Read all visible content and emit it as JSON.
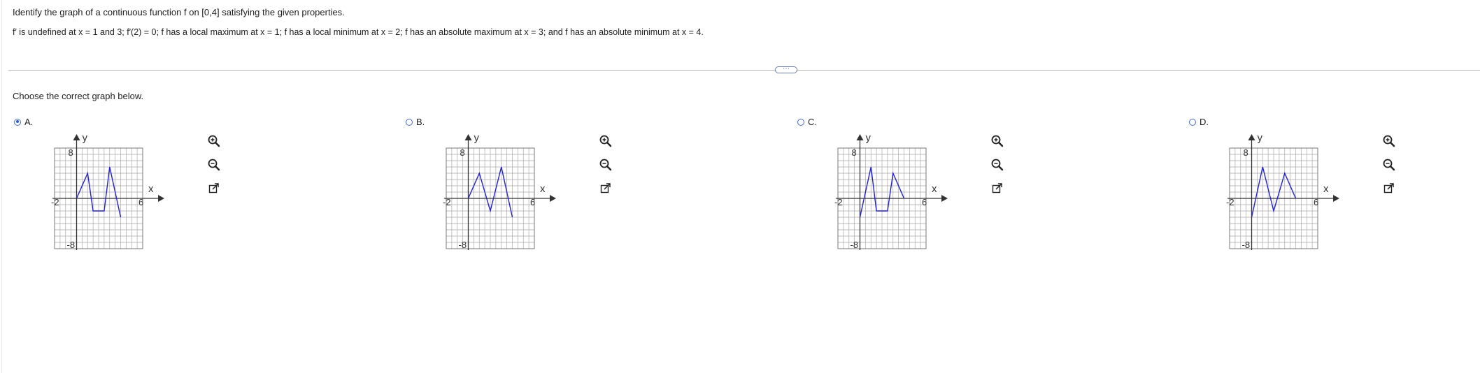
{
  "question": {
    "line1": "Identify the graph of a continuous function f on [0,4] satisfying the given properties.",
    "line2": "f′ is undefined at x = 1 and 3; f′(2) = 0; f has a local maximum at x = 1; f has a local minimum at x = 2; f has an absolute maximum at x = 3; and f has an absolute minimum at x = 4."
  },
  "more_button_label": "⋯",
  "prompt": "Choose the correct graph below.",
  "selected_option": "A",
  "colors": {
    "accent": "#2a5bd7",
    "curve": "#1f1fe0",
    "grid": "#a8a8a8",
    "axis": "#333333"
  },
  "icons": [
    "zoom-in-icon",
    "zoom-out-icon",
    "open-external-icon"
  ],
  "options": [
    {
      "label": "A.",
      "chart_data": {
        "type": "line",
        "x_tick_labels": [
          "-2",
          "6"
        ],
        "y_tick_labels": [
          "8",
          "-8"
        ],
        "xlabel": "x",
        "ylabel": "y",
        "xlim": [
          -2,
          6
        ],
        "ylim": [
          -8,
          8
        ],
        "grid": true,
        "series": [
          {
            "x": [
              0,
              1,
              1.5,
              2.5,
              3,
              4
            ],
            "y": [
              0,
              4,
              -2,
              -2,
              5,
              -3
            ]
          }
        ]
      }
    },
    {
      "label": "B.",
      "chart_data": {
        "type": "line",
        "x_tick_labels": [
          "-2",
          "6"
        ],
        "y_tick_labels": [
          "8",
          "-8"
        ],
        "xlabel": "x",
        "ylabel": "y",
        "xlim": [
          -2,
          6
        ],
        "ylim": [
          -8,
          8
        ],
        "grid": true,
        "series": [
          {
            "x": [
              0,
              1,
              2,
              3,
              4
            ],
            "y": [
              0,
              4,
              -2,
              5,
              -3
            ]
          }
        ]
      }
    },
    {
      "label": "C.",
      "chart_data": {
        "type": "line",
        "x_tick_labels": [
          "-2",
          "6"
        ],
        "y_tick_labels": [
          "8",
          "-8"
        ],
        "xlabel": "x",
        "ylabel": "y",
        "xlim": [
          -2,
          6
        ],
        "ylim": [
          -8,
          8
        ],
        "grid": true,
        "series": [
          {
            "x": [
              0,
              1,
              1.5,
              2.5,
              3,
              4
            ],
            "y": [
              -3,
              5,
              -2,
              -2,
              4,
              0
            ]
          }
        ]
      }
    },
    {
      "label": "D.",
      "chart_data": {
        "type": "line",
        "x_tick_labels": [
          "-2",
          "6"
        ],
        "y_tick_labels": [
          "8",
          "-8"
        ],
        "xlabel": "x",
        "ylabel": "y",
        "xlim": [
          -2,
          6
        ],
        "ylim": [
          -8,
          8
        ],
        "grid": true,
        "series": [
          {
            "x": [
              0,
              1,
              2,
              3,
              4
            ],
            "y": [
              -3,
              5,
              -2,
              4,
              0
            ]
          }
        ]
      }
    }
  ]
}
